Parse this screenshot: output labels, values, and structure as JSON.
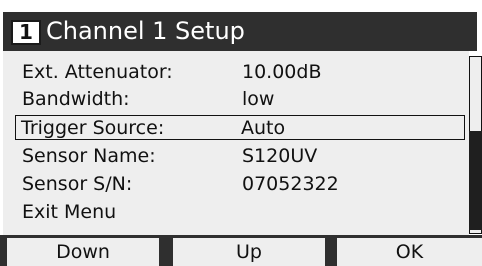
{
  "header": {
    "channel_number": "1",
    "title": "Channel 1 Setup"
  },
  "menu": {
    "items": [
      {
        "label": "Ext. Attenuator:",
        "value": "10.00dB"
      },
      {
        "label": "Bandwidth:",
        "value": "low"
      },
      {
        "label": "Trigger Source:",
        "value": "Auto"
      },
      {
        "label": "Sensor Name:",
        "value": "S120UV"
      },
      {
        "label": "Sensor S/N:",
        "value": "07052322"
      },
      {
        "label": "Exit Menu",
        "value": ""
      }
    ],
    "selected_index": 2
  },
  "softkeys": {
    "down": "Down",
    "up": "Up",
    "ok": "OK"
  },
  "colors": {
    "background": "#eeeeee",
    "titlebar": "#2f2f2f",
    "text": "#111111"
  }
}
